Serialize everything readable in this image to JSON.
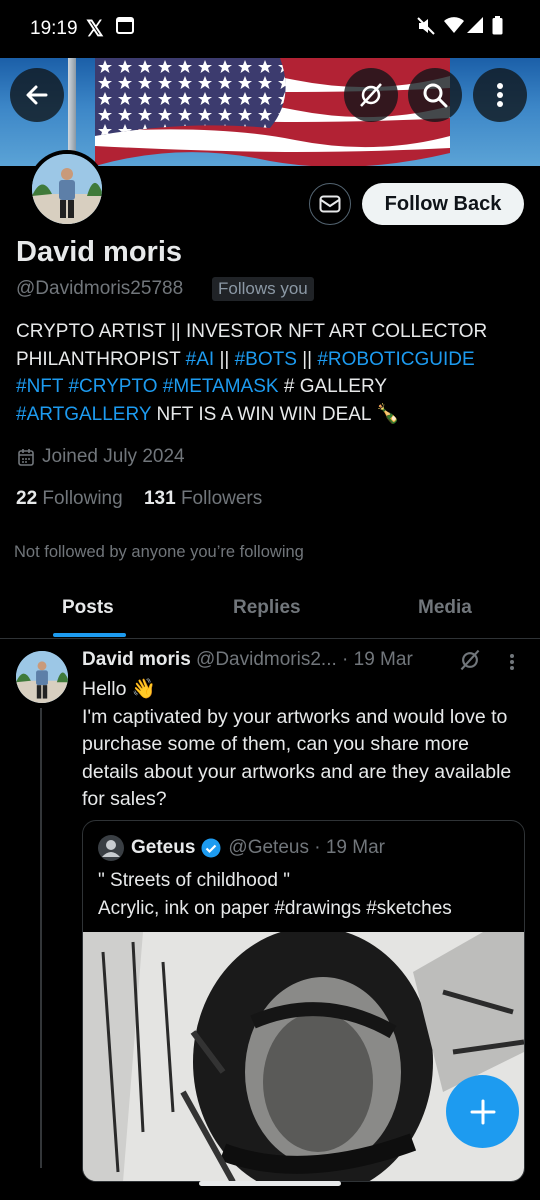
{
  "status_bar": {
    "time": "19:19"
  },
  "profile": {
    "name": "David moris",
    "handle": "@Davidmoris25788",
    "follows_you": "Follows you",
    "follow_back_label": "Follow Back",
    "bio_line1": "CRYPTO ARTIST || INVESTOR NFT ART COLLECTOR",
    "bio_line2_a": "PHILANTHROPIST ",
    "bio_tag_ai": "#AI",
    "bio_sep1": " || ",
    "bio_tag_bots": "#BOTS",
    "bio_sep2": " || ",
    "bio_tag_robotic": "#ROBOTICGUIDE",
    "bio_tag_nft": "#NFT",
    "bio_tag_crypto": "#CRYPTO",
    "bio_tag_metamask": "#METAMASK",
    "bio_gallery": " # GALLERY",
    "bio_tag_artgallery": "#ARTGALLERY",
    "bio_end": "  NFT IS A WIN WIN DEAL 🍾",
    "joined": "Joined July 2024",
    "following_count": "22",
    "following_label": "Following",
    "followers_count": "131",
    "followers_label": "Followers",
    "not_followed": "Not followed by anyone you’re following"
  },
  "tabs": [
    "Posts",
    "Replies",
    "Media"
  ],
  "post": {
    "author": "David moris",
    "handle_date": "@Davidmoris2... · 19 Mar",
    "text_line1": "Hello 👋",
    "text_rest": "I'm captivated by your artworks and would love to purchase some of them, can you share more details about your artworks and are they available for sales?",
    "quote": {
      "author": "Geteus",
      "handle_date": "@Geteus · 19 Mar",
      "line1": "\" Streets of childhood \"",
      "line2": "Acrylic, ink on paper #drawings #sketches"
    }
  },
  "colors": {
    "accent": "#1d9bf0",
    "background": "#000000",
    "secondary_text": "#71767b"
  },
  "icons": [
    "back-arrow-icon",
    "grok-slash-icon",
    "search-icon",
    "more-vertical-icon",
    "mail-icon",
    "calendar-icon",
    "verified-badge-icon",
    "plus-icon"
  ]
}
